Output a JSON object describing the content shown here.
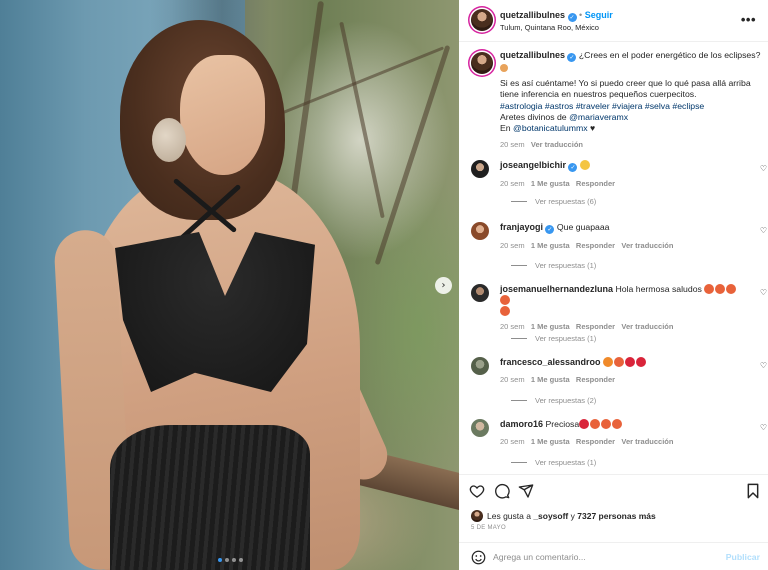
{
  "post": {
    "username": "quetzallibulnes",
    "follow_label": "Seguir",
    "location": "Tulum, Quintana Roo, México",
    "more_label": "•••"
  },
  "caption": {
    "line1": "¿Crees en el poder energético de los eclipses?",
    "body": "Si es así cuéntame! Yo si puedo creer que lo qué pasa allá arriba tiene inferencia en nuestros pequeños cuerpecitos.",
    "hashtags": "#astrologia #astros #traveler #viajera #selva #eclipse",
    "earrings_prefix": "Aretes divinos de ",
    "earrings_handle": "@mariaveramx",
    "place_prefix": "En ",
    "place_handle": "@botanicatulummx",
    "place_suffix": " ♥",
    "time": "20 sem",
    "translate": "Ver traducción"
  },
  "comments": [
    {
      "user": "joseangelbichir",
      "text": "",
      "verified": true,
      "time": "20 sem",
      "likes": "1 Me gusta",
      "reply": "Responder",
      "translate": "",
      "replies": "Ver respuestas (6)"
    },
    {
      "user": "franjayogi",
      "text": "Que guapaaa",
      "verified": true,
      "time": "20 sem",
      "likes": "1 Me gusta",
      "reply": "Responder",
      "translate": "Ver traducción",
      "replies": "Ver respuestas (1)"
    },
    {
      "user": "josemanuelhernandezluna",
      "text": "Hola hermosa saludos",
      "verified": false,
      "time": "20 sem",
      "likes": "1 Me gusta",
      "reply": "Responder",
      "translate": "Ver traducción",
      "replies": "Ver respuestas (1)"
    },
    {
      "user": "francesco_alessandroo",
      "text": "",
      "verified": false,
      "time": "20 sem",
      "likes": "1 Me gusta",
      "reply": "Responder",
      "translate": "",
      "replies": "Ver respuestas (2)"
    },
    {
      "user": "damoro16",
      "text": "Preciosa",
      "verified": false,
      "time": "20 sem",
      "likes": "1 Me gusta",
      "reply": "Responder",
      "translate": "Ver traducción",
      "replies": "Ver respuestas (1)"
    }
  ],
  "likes": {
    "prefix": "Les gusta a ",
    "user": "_soysoff",
    "middle": " y ",
    "count": "7327 personas más"
  },
  "date": "5 DE MAYO",
  "add_comment": {
    "placeholder": "Agrega un comentario...",
    "post_label": "Publicar"
  },
  "colors": {
    "accent": "#0095f6",
    "verified": "#3897f0",
    "muted": "#8e8e8e",
    "link": "#00376b"
  },
  "icons": [
    "heart-icon",
    "comment-icon",
    "share-icon",
    "bookmark-icon",
    "smiley-icon",
    "next-arrow-icon",
    "more-options-icon"
  ],
  "carousel": {
    "total": 4,
    "active": 1
  }
}
